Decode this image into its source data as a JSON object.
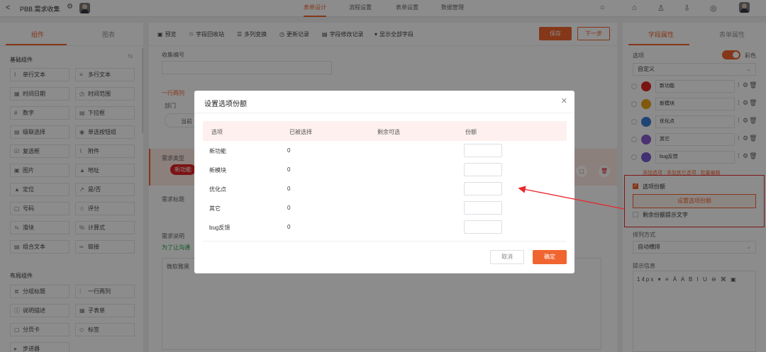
{
  "header": {
    "back_glyph": "<",
    "title": "PBB.需求收集",
    "tabs": [
      {
        "label": "表单设计",
        "active": true
      },
      {
        "label": "流程设置",
        "active": false
      },
      {
        "label": "表单设置",
        "active": false
      },
      {
        "label": "数据管理",
        "active": false
      }
    ],
    "icons": [
      "search-icon",
      "home-icon",
      "shirt-icon",
      "download-icon",
      "settings-icon"
    ]
  },
  "left_panel": {
    "tabs": [
      {
        "label": "组件",
        "active": true
      },
      {
        "label": "图表",
        "active": false
      }
    ],
    "basic_section": "基础组件",
    "basic_components": [
      {
        "icon": "I",
        "label": "单行文本"
      },
      {
        "icon": "≡",
        "label": "多行文本"
      },
      {
        "icon": "▦",
        "label": "时间日期"
      },
      {
        "icon": "◷",
        "label": "时间范围"
      },
      {
        "icon": "#",
        "label": "数字"
      },
      {
        "icon": "▤",
        "label": "下拉框"
      },
      {
        "icon": "▤",
        "label": "级联选择"
      },
      {
        "icon": "◉",
        "label": "单选按钮组"
      },
      {
        "icon": "☑",
        "label": "复选框"
      },
      {
        "icon": "⌇",
        "label": "附件"
      },
      {
        "icon": "▣",
        "label": "图片"
      },
      {
        "icon": "▲",
        "label": "地址"
      },
      {
        "icon": "▲",
        "label": "定位"
      },
      {
        "icon": "↗",
        "label": "是/否"
      },
      {
        "icon": "▢",
        "label": "号码"
      },
      {
        "icon": "☆",
        "label": "评分"
      },
      {
        "icon": "≒",
        "label": "滑块"
      },
      {
        "icon": "%",
        "label": "计算式"
      },
      {
        "icon": "▤",
        "label": "组合文本"
      },
      {
        "icon": "∞",
        "label": "链接"
      }
    ],
    "layout_section": "布局组件",
    "layout_components": [
      {
        "icon": "≣",
        "label": "分组标题"
      },
      {
        "icon": "⁞",
        "label": "一行两列"
      },
      {
        "icon": "ⓘ",
        "label": "说明描述"
      },
      {
        "icon": "▦",
        "label": "子表单"
      },
      {
        "icon": "▢",
        "label": "分页卡"
      },
      {
        "icon": "◇",
        "label": "标签"
      },
      {
        "icon": "▸",
        "label": "步进器"
      }
    ]
  },
  "toolbar": {
    "items": [
      {
        "icon": "▣",
        "label": "预览"
      },
      {
        "icon": "♲",
        "label": "字段回收站"
      },
      {
        "icon": "☰",
        "label": "多列变换"
      },
      {
        "icon": "◷",
        "label": "更新记录"
      },
      {
        "icon": "▤",
        "label": "字段修改记录"
      },
      {
        "icon": "▾",
        "label": "显示全部字段"
      }
    ],
    "save_label": "保存",
    "next_label": "下一步"
  },
  "canvas": {
    "field_1_label": "收集编号",
    "field_2_label": "一行两列",
    "field_2_sub": "部门",
    "field_2_value": "当前",
    "field_3_label": "需求类型",
    "field_3_value": "新功能",
    "field_4_label": "需求标题",
    "field_5_label": "需求说明",
    "field_5_hint": "为了让沟通",
    "field_5_placeholder": "微软雅黑"
  },
  "right_panel": {
    "tabs": [
      {
        "label": "字段属性",
        "active": true
      },
      {
        "label": "表单属性",
        "active": false
      }
    ],
    "options_label": "选项",
    "color_label": "彩色",
    "options_mode": "自定义",
    "options": [
      {
        "label": "新功能",
        "color": "#e02424"
      },
      {
        "label": "新模块",
        "color": "#e9a21b"
      },
      {
        "label": "优化点",
        "color": "#3a7fd5"
      },
      {
        "label": "其它",
        "color": "#8a5cd0"
      },
      {
        "label": "bug反馈",
        "color": "#7b5cd0"
      }
    ],
    "links": [
      "添加选项",
      "添加其它选项",
      "批量编辑"
    ],
    "quota_checkbox": "选项份额",
    "quota_button": "设置选项份额",
    "remain_checkbox": "剩余份额提示文字",
    "arrange_label": "排列方式",
    "arrange_value": "自动横排",
    "hint_label": "提示信息",
    "rte_size": "14px"
  },
  "modal": {
    "title": "设置选项份额",
    "columns": [
      "选项",
      "已被选择",
      "剩余可选",
      "份额"
    ],
    "rows": [
      {
        "option": "新功能",
        "selected": "0",
        "remaining": "",
        "quota": ""
      },
      {
        "option": "新模块",
        "selected": "0",
        "remaining": "",
        "quota": ""
      },
      {
        "option": "优化点",
        "selected": "0",
        "remaining": "",
        "quota": ""
      },
      {
        "option": "其它",
        "selected": "0",
        "remaining": "",
        "quota": ""
      },
      {
        "option": "bug反馈",
        "selected": "0",
        "remaining": "",
        "quota": ""
      }
    ],
    "cancel_label": "取消",
    "ok_label": "确定"
  },
  "colors": {
    "accent": "#f0652f",
    "annotation": "#e8272c"
  }
}
